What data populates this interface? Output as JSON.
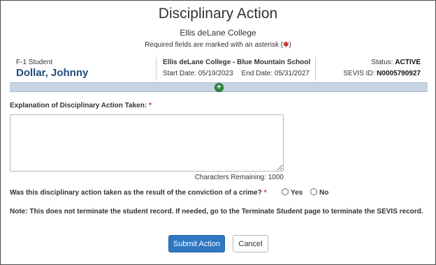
{
  "page": {
    "title": "Disciplinary Action",
    "school": "Ellis deLane College",
    "required_note_prefix": "Required fields are marked with an asterisk (",
    "required_note_asterisk": "✱",
    "required_note_suffix": ")"
  },
  "student": {
    "type_label": "F-1 Student",
    "name": "Dollar, Johnny",
    "program": "Ellis deLane College - Blue Mountain School",
    "start_label": "Start Date:",
    "start_date": "05/19/2023",
    "end_label": "End Date:",
    "end_date": "05/31/2027",
    "status_label": "Status:",
    "status": "ACTIVE",
    "sevis_label": "SEVIS ID:",
    "sevis_id": "N0005790927"
  },
  "expand_icon": "plus-circle-icon",
  "form": {
    "explanation_label": "Explanation of Disciplinary Action Taken:",
    "required_mark": "*",
    "explanation_value": "",
    "chars_remaining_label": "Characters Remaining:",
    "chars_remaining": "1000",
    "question": "Was this disciplinary action taken as the result of the conviction of a crime?",
    "options": [
      "Yes",
      "No"
    ],
    "note": "Note: This does not terminate the student record. If needed, go to the Terminate Student page to terminate the SEVIS record."
  },
  "buttons": {
    "submit": "Submit Action",
    "cancel": "Cancel"
  },
  "colors": {
    "accent": "#2e78c2",
    "student_name": "#1f4b7d",
    "band": "#c5d3e2",
    "expand_icon": "#2b8a3e",
    "required": "#c9302c"
  }
}
